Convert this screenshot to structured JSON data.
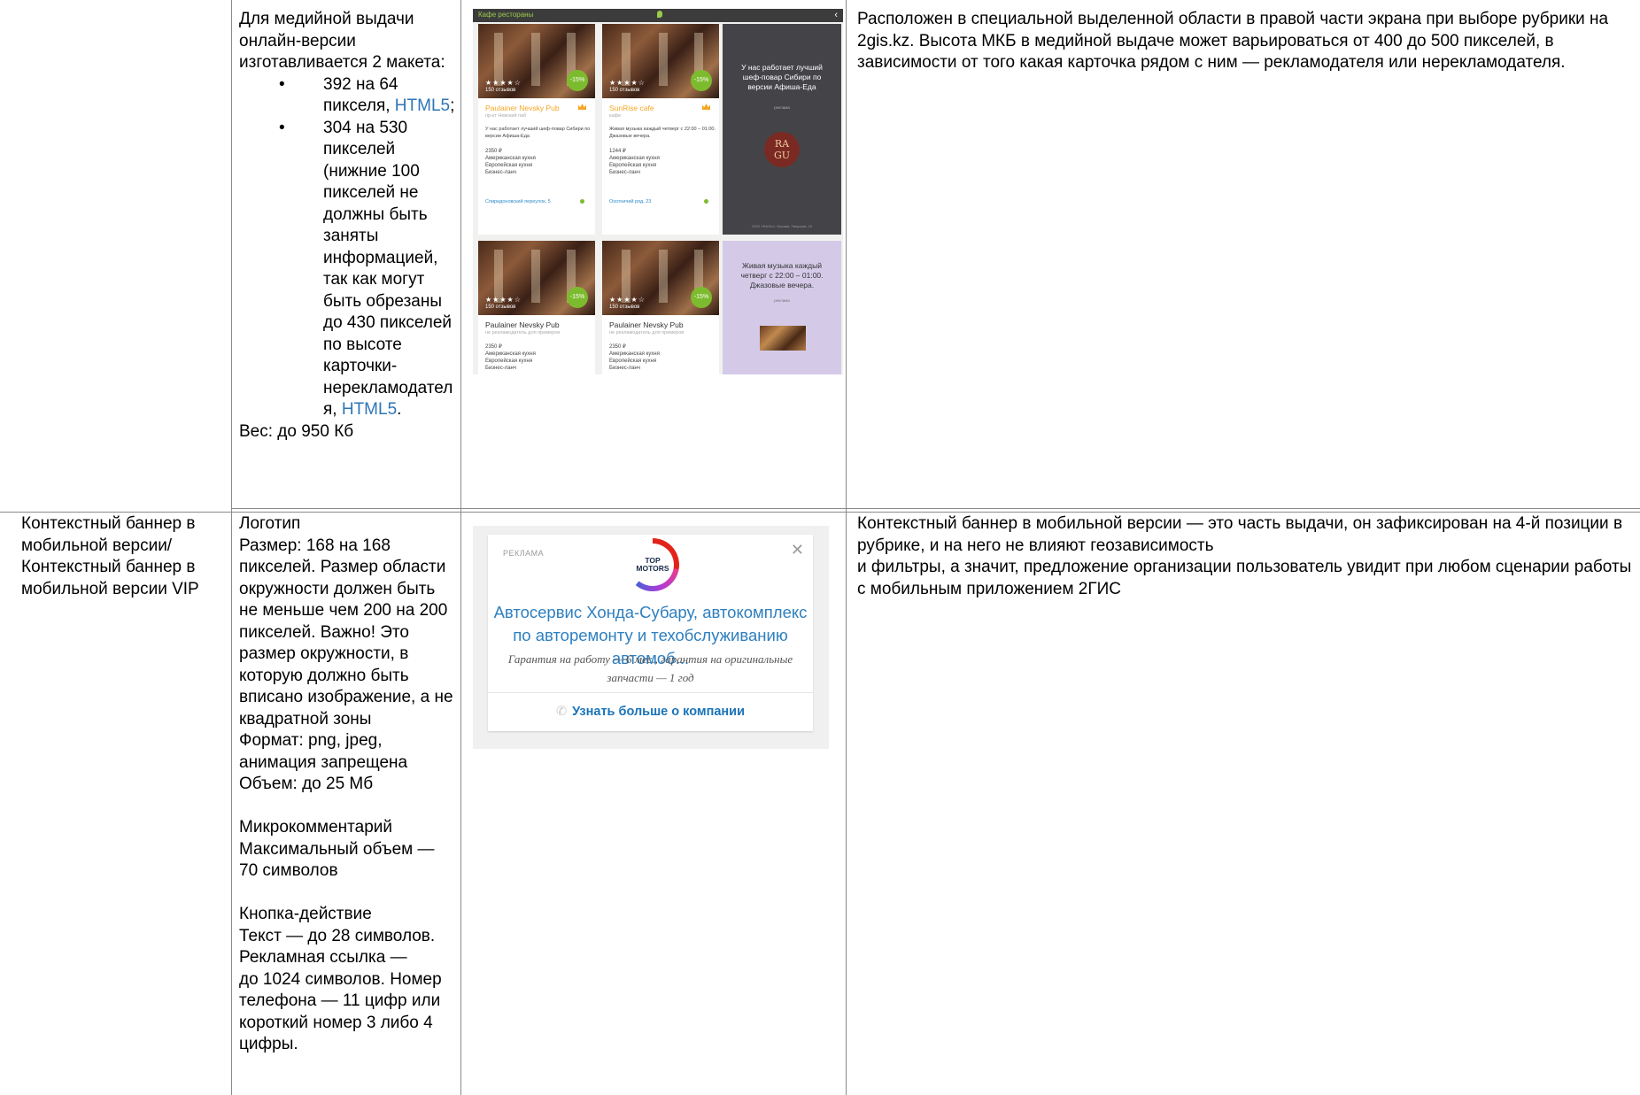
{
  "row1": {
    "col1": "",
    "col2": {
      "intro": "Для медийной выдачи онлайн-версии изготавливается 2 макета:",
      "items": [
        {
          "text": "392 на 64 пикселя, ",
          "link": "HTML5",
          "tail": ";"
        },
        {
          "text": "304 на 530 пикселей (нижние 100 пикселей не должны быть заняты информацией, так как могут быть обрезаны до 430 пикселей по высоте карточки-нерекламодателя, ",
          "link": "HTML5",
          "tail": "."
        }
      ],
      "weight": "Вес: до 950 Кб"
    },
    "screenshot": {
      "topbar": "Кафе рестораны",
      "cards": [
        {
          "name": "Paulainer Nevsky Pub",
          "sub": "пр-кт Невский паб",
          "text": "У нас работает лучший шеф-повар Сибири по версии Афиша-Еда",
          "price": "2350 ₽\nАмериканская кухня\nЕвропейская кухня\nБизнес-ланч",
          "footer": "Спиридоновский переулок, 5",
          "badge": "-15%",
          "stars": "★★★★☆",
          "reviews": "150 отзывов"
        },
        {
          "name": "SunRise cafe",
          "sub": "кафе",
          "text": "Живая музыка каждый четверг с 22:00 – 01:00. Джазовые вечера.",
          "price": "1244 ₽\nАмериканская кухня\nЕвропейская кухня\nБизнес-ланч",
          "footer": "Охотничий ряд, 23",
          "badge": "-15%",
          "stars": "★★★★☆",
          "reviews": "150 отзывов"
        },
        {
          "name": "Paulainer Nevsky Pub",
          "sub": "не рекламодатель для примеров",
          "text": "",
          "price": "2350 ₽\nАмериканская кухня\nЕвропейская кухня\nБизнес-ланч",
          "footer": "",
          "badge": "-15%",
          "stars": "★★★★☆",
          "reviews": "150 отзывов"
        },
        {
          "name": "Paulainer Nevsky Pub",
          "sub": "не рекламодатель для примеров",
          "text": "",
          "price": "2350 ₽\nАмериканская кухня\nЕвропейская кухня\nБизнес-ланч",
          "footer": "",
          "badge": "-15%",
          "stars": "★★★★☆",
          "reviews": "150 отзывов"
        }
      ],
      "ad_dark": {
        "headline": "У нас работает лучший шеф-повар Сибири по версии Афиша-Еда",
        "sub": "реклама",
        "logo": "RA\nGU",
        "footer": "ООО «RAGU», Москва, Тверская, 10"
      },
      "ad_lilac": {
        "headline": "Живая музыка каждый четверг с 22:00 – 01:00. Джазовые вечера.",
        "sub": "реклама"
      }
    },
    "col4": "Расположен в специальной выделенной области в правой части экрана при выборе рубрики на 2gis.kz. Высота МКБ в медийной выдаче может варьироваться от 400 до 500 пикселей, в зависимости от того какая карточка рядом с ним — рекламодателя или нерекламодателя."
  },
  "row2": {
    "col1": "Контекстный баннер в мобильной версии/ Контекстный баннер в мобильной версии VIP",
    "col2": {
      "logo_block": "Логотип\nРазмер: 168 на 168 пикселей. Размер области окружности должен быть не меньше чем 200 на 200 пикселей. Важно! Это размер окружности, в которую должно быть вписано изображение, а не квадратной зоны\nФормат: png, jpeg, анимация запрещена\nОбъем: до 25 Мб",
      "micro_block": "Микрокомментарий\nМаксимальный объем — 70 символов",
      "button_block": "Кнопка-действие\nТекст — до 28 символов. Рекламная ссылка —\nдо 1024 символов. Номер телефона — 11 цифр или короткий номер 3 либо 4 цифры."
    },
    "banner": {
      "label": "РЕКЛАМА",
      "logo_text": "TOP\nMOTORS",
      "title": "Автосервис Хонда-Субару, автокомплекс по авторемонту и техобслуживанию автомоб...",
      "desc": "Гарантия на работу — 6 мес., гарантия на оригинальные запчасти — 1 год",
      "cta": "Узнать больше о компании"
    },
    "col4": "Контекстный баннер в мобильной версии — это часть выдачи, он зафиксирован на 4-й позиции в рубрике, и на него не влияют геозависимость\nи фильтры, а значит, предложение организации пользователь увидит при любом сценарии работы с мобильным приложением 2ГИС"
  },
  "colors": {
    "link": "#2e75b6",
    "grid": "#8a8a8a",
    "banner_title": "#2e7fbf",
    "accent_green": "#7dbb2e",
    "accent_orange": "#f5a623"
  }
}
